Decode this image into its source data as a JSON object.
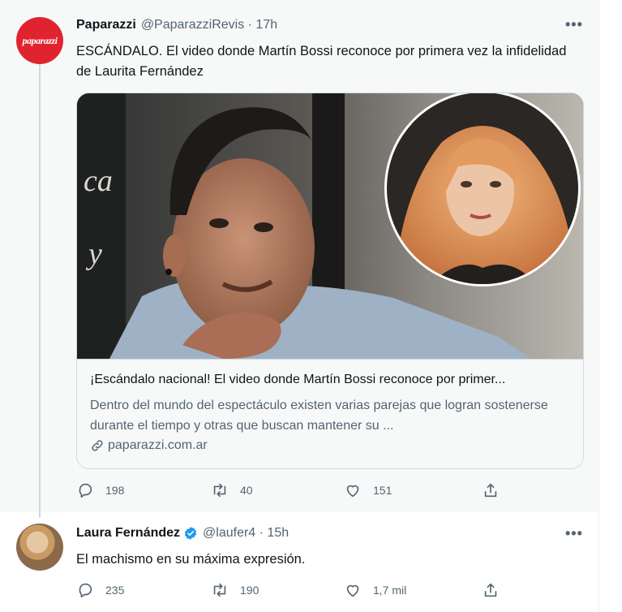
{
  "tweet1": {
    "name": "Paparazzi",
    "handle": "@PaparazziRevis · 17h",
    "avatar_text": "paparazzi",
    "text": "ESCÁNDALO. El video donde Martín Bossi reconoce por primera vez la infidelidad de Laurita Fernández",
    "card": {
      "title": "¡Escándalo nacional! El video donde Martín Bossi reconoce por primer...",
      "description": "Dentro del mundo del espectáculo existen varias parejas que logran sostenerse durante el tiempo y otras que buscan mantener su ...",
      "domain": "paparazzi.com.ar"
    },
    "replies": "198",
    "retweets": "40",
    "likes": "151"
  },
  "tweet2": {
    "name": "Laura Fernández",
    "handle": "@laufer4 · 15h",
    "text": "El machismo en su máxima expresión.",
    "replies": "235",
    "retweets": "190",
    "likes": "1,7 mil"
  },
  "colors": {
    "accent": "#1d9bf0",
    "secondary_text": "#536471",
    "brand_red": "#e0242f"
  },
  "icons": [
    "more-icon",
    "verified-icon",
    "link-icon",
    "reply-icon",
    "retweet-icon",
    "like-icon",
    "share-icon"
  ]
}
